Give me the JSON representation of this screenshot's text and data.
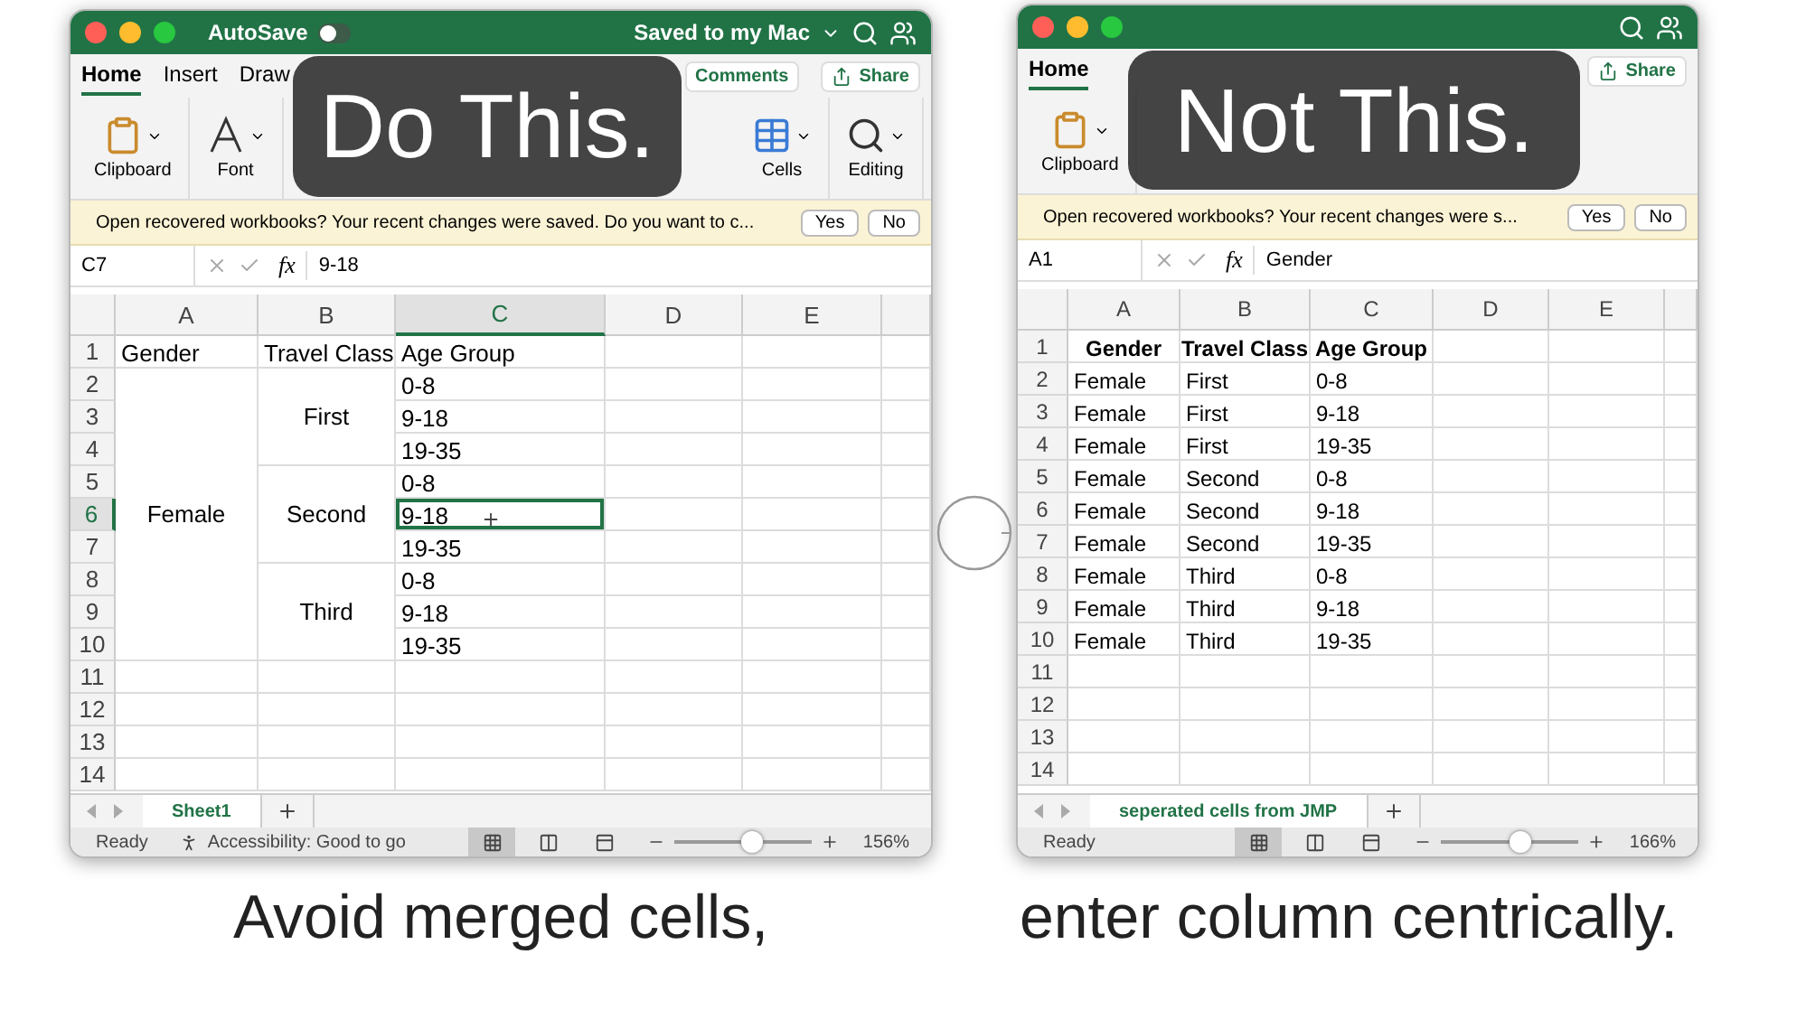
{
  "windows": [
    {
      "kind": "merged",
      "overlay_label": "Do This.",
      "autosave": {
        "label": "AutoSave",
        "on": false
      },
      "save_status": "Saved to my Mac",
      "ribbon_tabs": [
        {
          "label": "Home",
          "selected": true
        },
        {
          "label": "Insert",
          "selected": false
        },
        {
          "label": "Draw",
          "selected": false
        }
      ],
      "ribbon_buttons": [
        "Comments",
        "Share"
      ],
      "ribbon_groups_left": [
        "Clipboard",
        "Font"
      ],
      "ribbon_groups_right": [
        "Cells",
        "Editing"
      ],
      "message": "Open recovered workbooks?  Your recent changes were saved. Do you want to c...",
      "message_buttons": [
        "Yes",
        "No"
      ],
      "name_box": "C7",
      "function_label": "fx",
      "formula": "9-18",
      "columns": [
        {
          "label": "A",
          "selected": false
        },
        {
          "label": "B",
          "selected": false
        },
        {
          "label": "C",
          "selected": true
        },
        {
          "label": "D",
          "selected": false
        },
        {
          "label": "E",
          "selected": false
        }
      ],
      "row_numbers": [
        {
          "label": "1",
          "selected": false
        },
        {
          "label": "2",
          "selected": false
        },
        {
          "label": "3",
          "selected": false
        },
        {
          "label": "4",
          "selected": false
        },
        {
          "label": "5",
          "selected": false
        },
        {
          "label": "6",
          "selected": true
        },
        {
          "label": "7",
          "selected": false
        },
        {
          "label": "8",
          "selected": false
        },
        {
          "label": "9",
          "selected": false
        },
        {
          "label": "10",
          "selected": false
        },
        {
          "label": "11",
          "selected": false
        },
        {
          "label": "12",
          "selected": false
        },
        {
          "label": "13",
          "selected": false
        },
        {
          "label": "14",
          "selected": false
        }
      ],
      "header": [
        "Gender",
        "Travel Class",
        "Age Group"
      ],
      "groups": [
        {
          "text": "Female",
          "children": [
            {
              "text": "First",
              "children": [
                {
                  "text": "0-8",
                  "selected": false
                },
                {
                  "text": "9-18",
                  "selected": false
                },
                {
                  "text": "19-35",
                  "selected": false
                }
              ]
            },
            {
              "text": "Second",
              "children": [
                {
                  "text": "0-8",
                  "selected": false
                },
                {
                  "text": "9-18",
                  "selected": true
                },
                {
                  "text": "19-35",
                  "selected": false
                }
              ]
            },
            {
              "text": "Third",
              "children": [
                {
                  "text": "0-8",
                  "selected": false
                },
                {
                  "text": "9-18",
                  "selected": false
                },
                {
                  "text": "19-35",
                  "selected": false
                }
              ]
            }
          ]
        }
      ],
      "sheet_tabs": [
        {
          "label": "Sheet1",
          "selected": true
        }
      ],
      "status": "Ready",
      "accessibility": "Accessibility: Good to go",
      "zoom": {
        "level": 0.56,
        "reading": "156%"
      },
      "caption": "Avoid merged cells,"
    },
    {
      "kind": "flat",
      "overlay_label": "Not This.",
      "ribbon_tabs": [
        {
          "label": "Home",
          "selected": true
        }
      ],
      "ribbon_buttons": [
        "Share"
      ],
      "ribbon_groups_left": [
        "Clipboard"
      ],
      "message": "Open recovered workbooks?  Your recent changes were s...",
      "message_buttons": [
        "Yes",
        "No"
      ],
      "name_box": "A1",
      "function_label": "fx",
      "formula": "Gender",
      "columns": [
        {
          "label": "A",
          "selected": false
        },
        {
          "label": "B",
          "selected": false
        },
        {
          "label": "C",
          "selected": false
        },
        {
          "label": "D",
          "selected": false
        },
        {
          "label": "E",
          "selected": false
        }
      ],
      "row_numbers": [
        {
          "label": "1",
          "selected": false
        },
        {
          "label": "2",
          "selected": false
        },
        {
          "label": "3",
          "selected": false
        },
        {
          "label": "4",
          "selected": false
        },
        {
          "label": "5",
          "selected": false
        },
        {
          "label": "6",
          "selected": false
        },
        {
          "label": "7",
          "selected": false
        },
        {
          "label": "8",
          "selected": false
        },
        {
          "label": "9",
          "selected": false
        },
        {
          "label": "10",
          "selected": false
        },
        {
          "label": "11",
          "selected": false
        },
        {
          "label": "12",
          "selected": false
        },
        {
          "label": "13",
          "selected": false
        },
        {
          "label": "14",
          "selected": false
        }
      ],
      "header": [
        "Gender",
        "Travel Class",
        "Age Group"
      ],
      "rows": [
        [
          "Female",
          "First",
          "0-8"
        ],
        [
          "Female",
          "First",
          "9-18"
        ],
        [
          "Female",
          "First",
          "19-35"
        ],
        [
          "Female",
          "Second",
          "0-8"
        ],
        [
          "Female",
          "Second",
          "9-18"
        ],
        [
          "Female",
          "Second",
          "19-35"
        ],
        [
          "Female",
          "Third",
          "0-8"
        ],
        [
          "Female",
          "Third",
          "9-18"
        ],
        [
          "Female",
          "Third",
          "19-35"
        ]
      ],
      "sheet_tabs": [
        {
          "label": "seperated cells from JMP",
          "selected": true
        }
      ],
      "status": "Ready",
      "zoom": {
        "level": 0.57,
        "reading": "166%"
      },
      "caption": "enter column centrically."
    }
  ]
}
